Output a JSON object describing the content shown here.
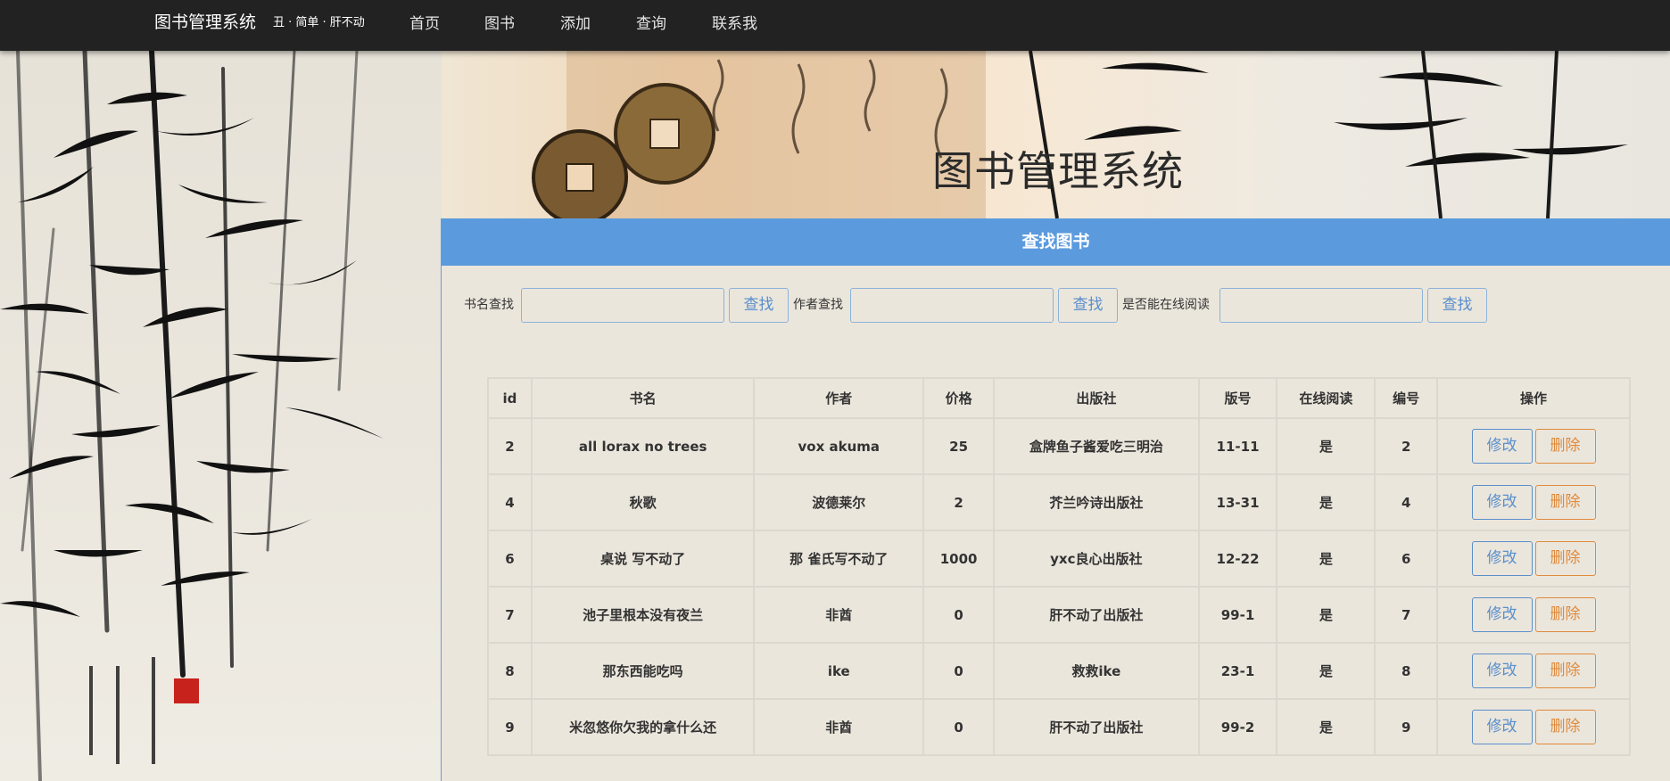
{
  "nav": {
    "brand": "图书管理系统",
    "motto": "丑 · 简单 · 肝不动",
    "links": [
      "首页",
      "图书",
      "添加",
      "查询",
      "联系我"
    ]
  },
  "banner": {
    "title": "图书管理系统"
  },
  "panel": {
    "heading": "查找图书",
    "search": [
      {
        "label": "书名查找",
        "value": "",
        "button": "查找"
      },
      {
        "label": "作者查找",
        "value": "",
        "button": "查找"
      },
      {
        "label": "是否能在线阅读",
        "value": "",
        "button": "查找"
      }
    ]
  },
  "table": {
    "headers": [
      "id",
      "书名",
      "作者",
      "价格",
      "出版社",
      "版号",
      "在线阅读",
      "编号",
      "操作"
    ],
    "rows": [
      [
        "2",
        "all lorax no trees",
        "vox akuma",
        "25",
        "盒牌鱼子酱爱吃三明治",
        "11-11",
        "是",
        "2"
      ],
      [
        "4",
        "秋歌",
        "波德莱尔",
        "2",
        "芥兰吟诗出版社",
        "13-31",
        "是",
        "4"
      ],
      [
        "6",
        "桌说 写不动了",
        "那 雀氏写不动了",
        "1000",
        "yxc良心出版社",
        "12-22",
        "是",
        "6"
      ],
      [
        "7",
        "池子里根本没有夜兰",
        "非酋",
        "0",
        "肝不动了出版社",
        "99-1",
        "是",
        "7"
      ],
      [
        "8",
        "那东西能吃吗",
        "ike",
        "0",
        "救救ike",
        "23-1",
        "是",
        "8"
      ],
      [
        "9",
        "米忽悠你欠我的拿什么还",
        "非酋",
        "0",
        "肝不动了出版社",
        "99-2",
        "是",
        "9"
      ]
    ],
    "edit_label": "修改",
    "delete_label": "删除"
  },
  "colors": {
    "navbar": "#222222",
    "panel_heading": "#5b9bdd",
    "edit_button": "#5a8fcc",
    "delete_button": "#e08a3c"
  }
}
